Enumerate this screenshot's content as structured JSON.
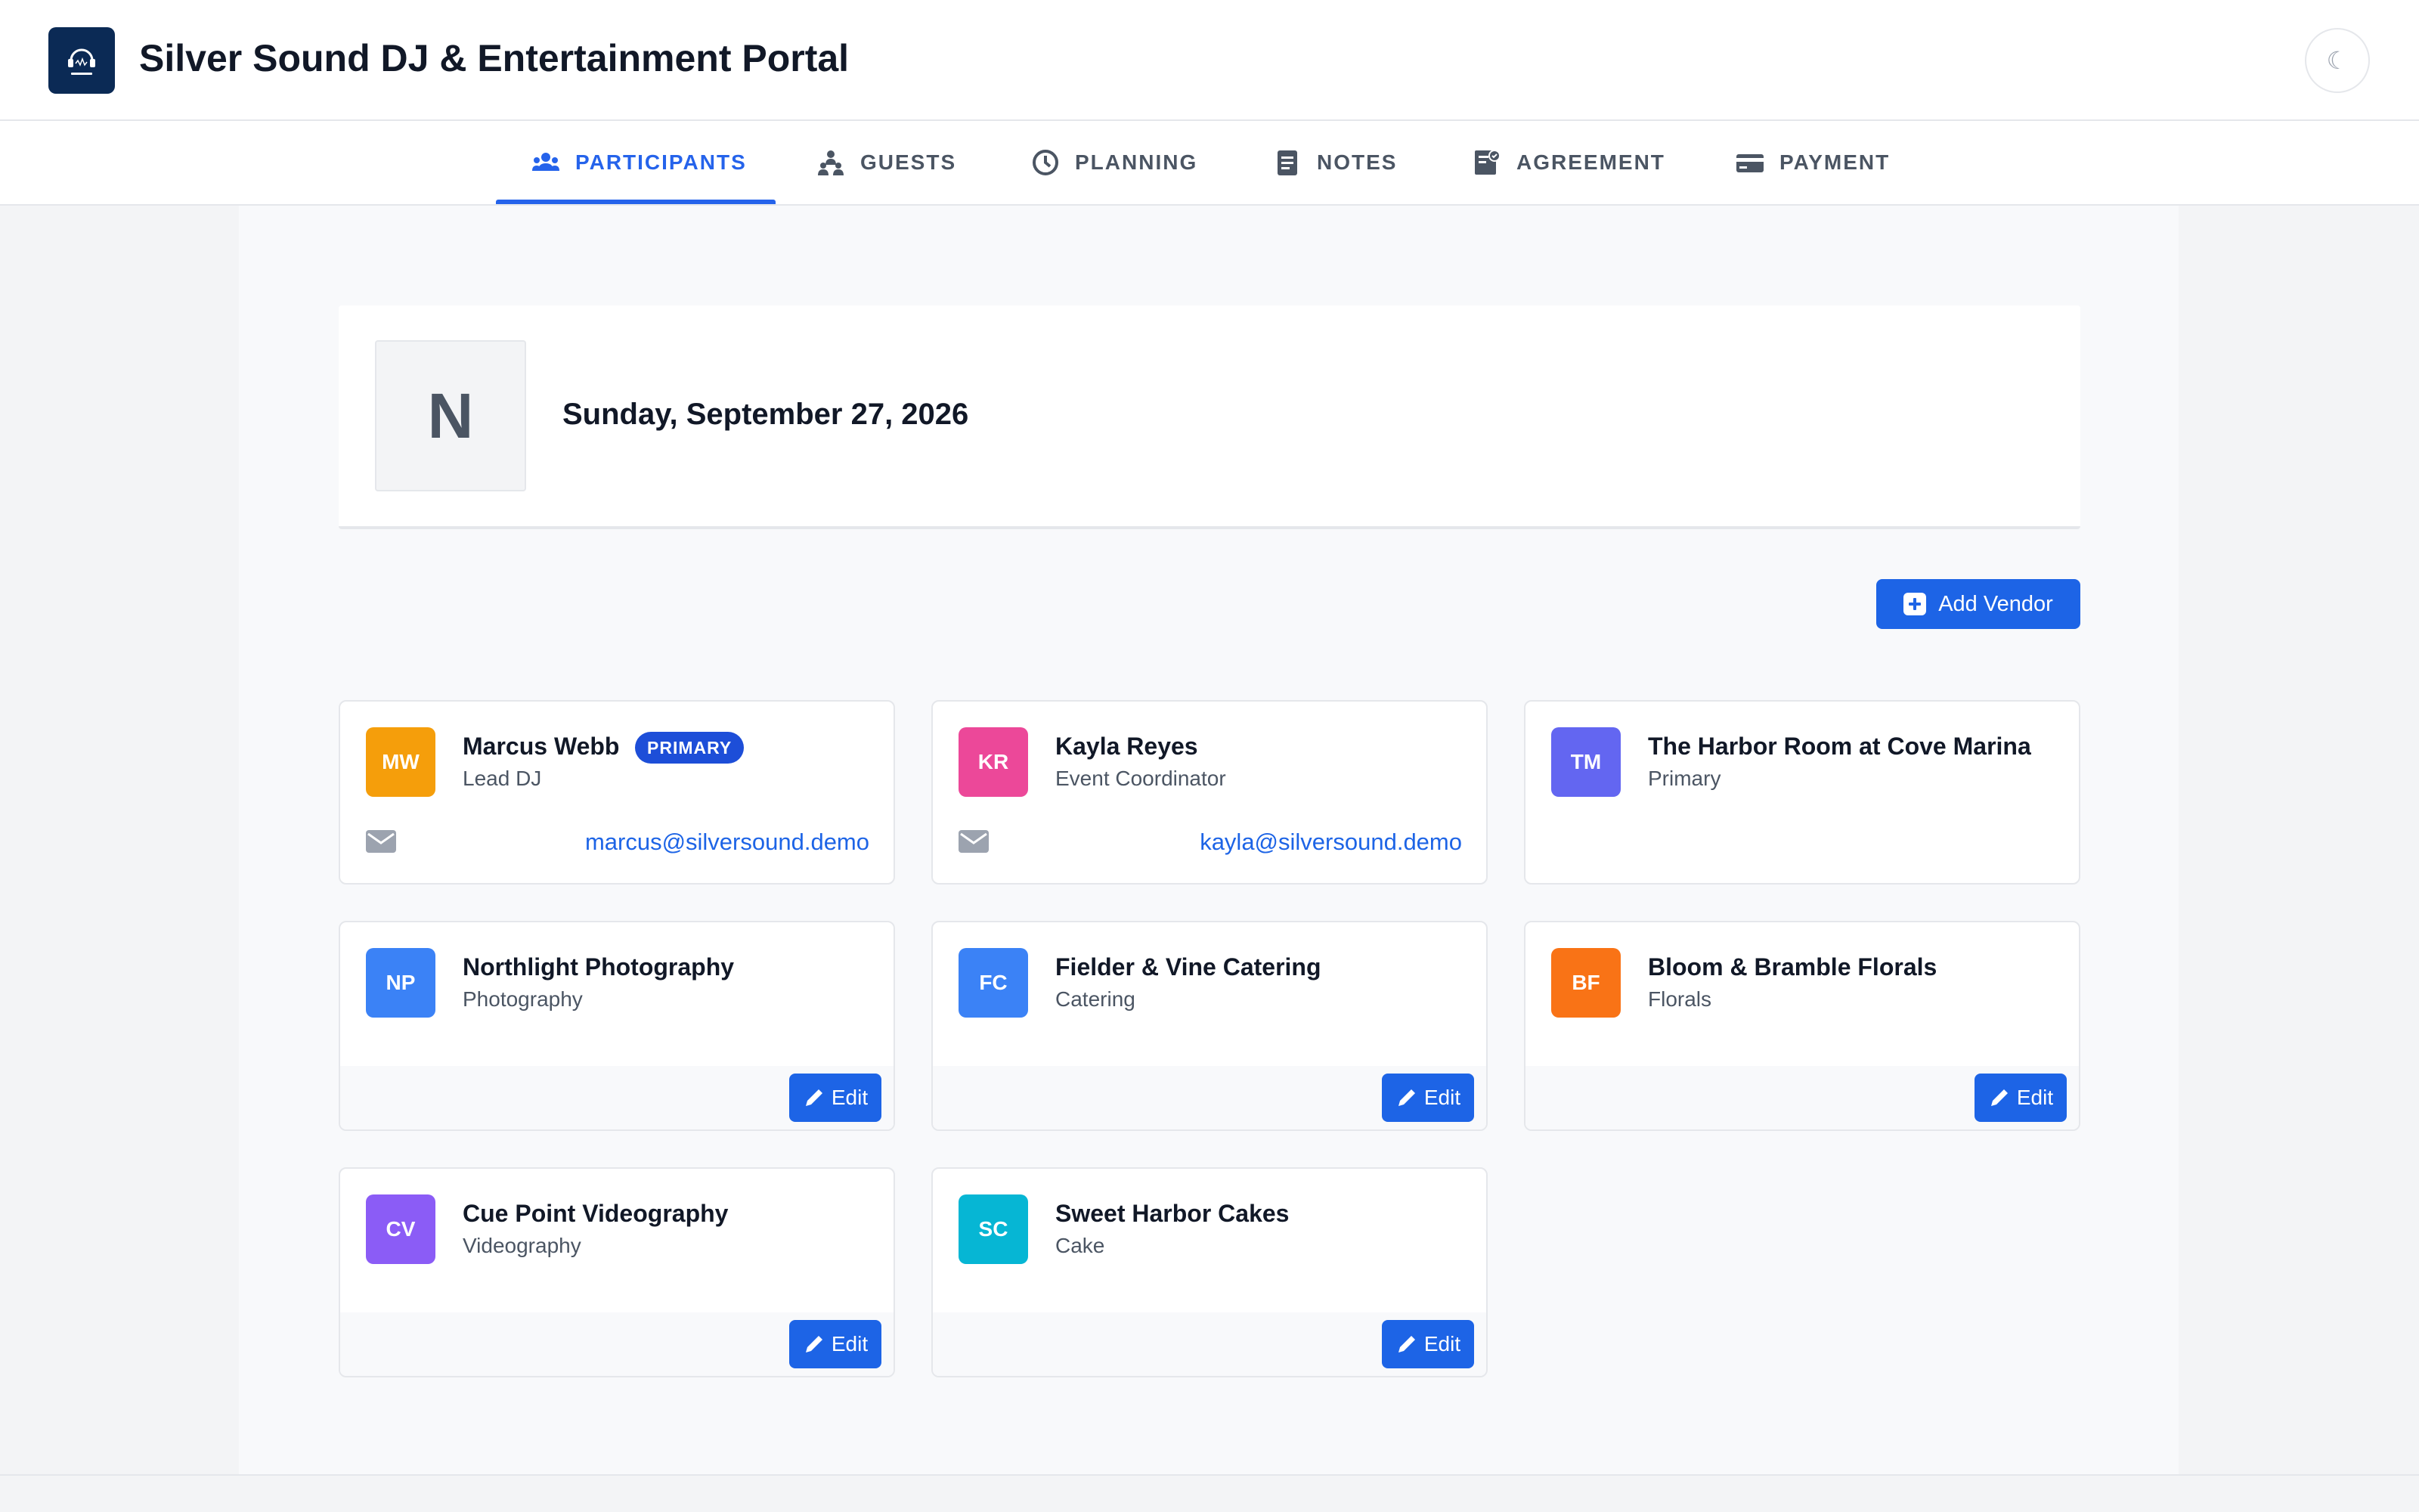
{
  "app": {
    "title": "Silver Sound DJ & Entertainment Portal",
    "logo_icon": "headphones-logo-icon",
    "theme_toggle_glyph": "☾"
  },
  "tabs": [
    {
      "label": "PARTICIPANTS",
      "icon": "participants-icon",
      "active": true
    },
    {
      "label": "GUESTS",
      "icon": "guests-icon",
      "active": false
    },
    {
      "label": "PLANNING",
      "icon": "planning-icon",
      "active": false
    },
    {
      "label": "NOTES",
      "icon": "notes-icon",
      "active": false
    },
    {
      "label": "AGREEMENT",
      "icon": "agreement-icon",
      "active": false
    },
    {
      "label": "PAYMENT",
      "icon": "payment-icon",
      "active": false
    }
  ],
  "event": {
    "initial": "N",
    "date": "Sunday, September 27, 2026"
  },
  "actions": {
    "add_vendor_label": "Add Vendor",
    "edit_label": "Edit"
  },
  "colors": {
    "accent": "#1d64e6",
    "badge": "#1d4ed8"
  },
  "participants": [
    {
      "initials": "MW",
      "name": "Marcus Webb",
      "role": "Lead DJ",
      "badge": "PRIMARY",
      "email": "marcus@silversound.demo",
      "color": "#f59e0b"
    },
    {
      "initials": "KR",
      "name": "Kayla Reyes",
      "role": "Event Coordinator",
      "email": "kayla@silversound.demo",
      "color": "#ec4899"
    },
    {
      "initials": "TM",
      "name": "The Harbor Room at Cove Marina",
      "role": "Primary",
      "color": "#6366f1"
    },
    {
      "initials": "NP",
      "name": "Northlight Photography",
      "role": "Photography",
      "color": "#3b82f6"
    },
    {
      "initials": "FC",
      "name": "Fielder & Vine Catering",
      "role": "Catering",
      "color": "#3b82f6"
    },
    {
      "initials": "BF",
      "name": "Bloom & Bramble Florals",
      "role": "Florals",
      "color": "#f97316"
    },
    {
      "initials": "CV",
      "name": "Cue Point Videography",
      "role": "Videography",
      "color": "#8b5cf6"
    },
    {
      "initials": "SC",
      "name": "Sweet Harbor Cakes",
      "role": "Cake",
      "color": "#06b6d4"
    }
  ]
}
